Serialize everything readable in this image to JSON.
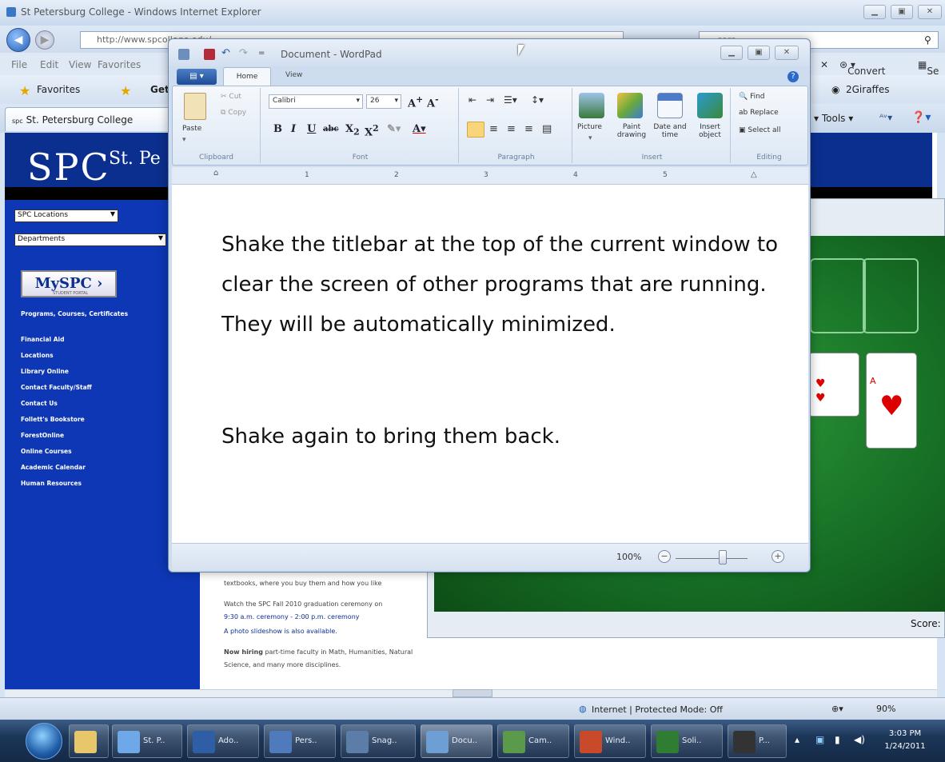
{
  "ie": {
    "title": "St Petersburg College - Windows Internet Explorer",
    "url": "http://www.spcollege.edu/",
    "search": "coro",
    "menu": [
      "File",
      "Edit",
      "View",
      "Favorites"
    ],
    "favorites_label": "Favorites",
    "get_label": "Get",
    "convert_label": "Convert",
    "se_label": "Se",
    "giraffes_label": "2Giraffes",
    "tab_label": "St. Petersburg College",
    "tools_label": "Tools",
    "status_zone": "Internet | Protected Mode: Off",
    "zoom": "90%"
  },
  "site": {
    "logo": "SPC",
    "name": "St. Pe",
    "locations_select": "SPC Locations",
    "departments_select": "Departments",
    "myspc": "MySPC ›",
    "myspc_sub": "STUDENT PORTAL",
    "links": [
      "Programs, Courses, Certificates",
      "Financial Aid",
      "Locations",
      "Library Online",
      "Contact Faculty/Staff",
      "Contact Us",
      "Follett's Bookstore",
      "ForestOnline",
      "Online Courses",
      "Academic Calendar",
      "Human Resources"
    ],
    "content": {
      "line1": "textbooks, where you buy them and how you like",
      "line2": "Watch the SPC Fall 2010 graduation ceremony on",
      "line3": "9:30 a.m. ceremony - 2:00 p.m. ceremony",
      "line4": "A photo slideshow is also available.",
      "line5_bold": "Now hiring",
      "line5": " part-time faculty in Math, Humanities, Natural",
      "line6": "Science, and many more disciplines."
    }
  },
  "solitaire": {
    "score": "Score: "
  },
  "wordpad": {
    "title": "Document - WordPad",
    "tabs": {
      "home": "Home",
      "view": "View"
    },
    "clipboard": {
      "paste": "Paste",
      "cut": "Cut",
      "copy": "Copy",
      "label": "Clipboard"
    },
    "font": {
      "name": "Calibri",
      "size": "26",
      "label": "Font"
    },
    "paragraph_label": "Paragraph",
    "insert": {
      "picture": "Picture",
      "paint": "Paint drawing",
      "datetime": "Date and time",
      "object": "Insert object",
      "label": "Insert"
    },
    "editing": {
      "find": "Find",
      "replace": "Replace",
      "select_all": "Select all",
      "label": "Editing"
    },
    "ruler": [
      "1",
      "2",
      "3",
      "4",
      "5"
    ],
    "paragraphs": [
      "Shake the titlebar at the top of the current window to clear the screen of other programs that are running. They will be automatically minimized.",
      "Shake again to bring them back."
    ],
    "zoom": "100%"
  },
  "taskbar": {
    "items": [
      {
        "label": "St. P..",
        "color": "#6fa8e8"
      },
      {
        "label": "Ado..",
        "color": "#2e5fa6"
      },
      {
        "label": "Pers..",
        "color": "#4f7bbd"
      },
      {
        "label": "Snag..",
        "color": "#5b7da8"
      },
      {
        "label": "Docu..",
        "color": "#6e9fd4"
      },
      {
        "label": "Cam..",
        "color": "#5a9a4a"
      },
      {
        "label": "Wind..",
        "color": "#c84a2a"
      },
      {
        "label": "Soli..",
        "color": "#2e7d32"
      },
      {
        "label": "P...",
        "color": "#333333"
      }
    ],
    "time": "3:03 PM",
    "date": "1/24/2011"
  }
}
